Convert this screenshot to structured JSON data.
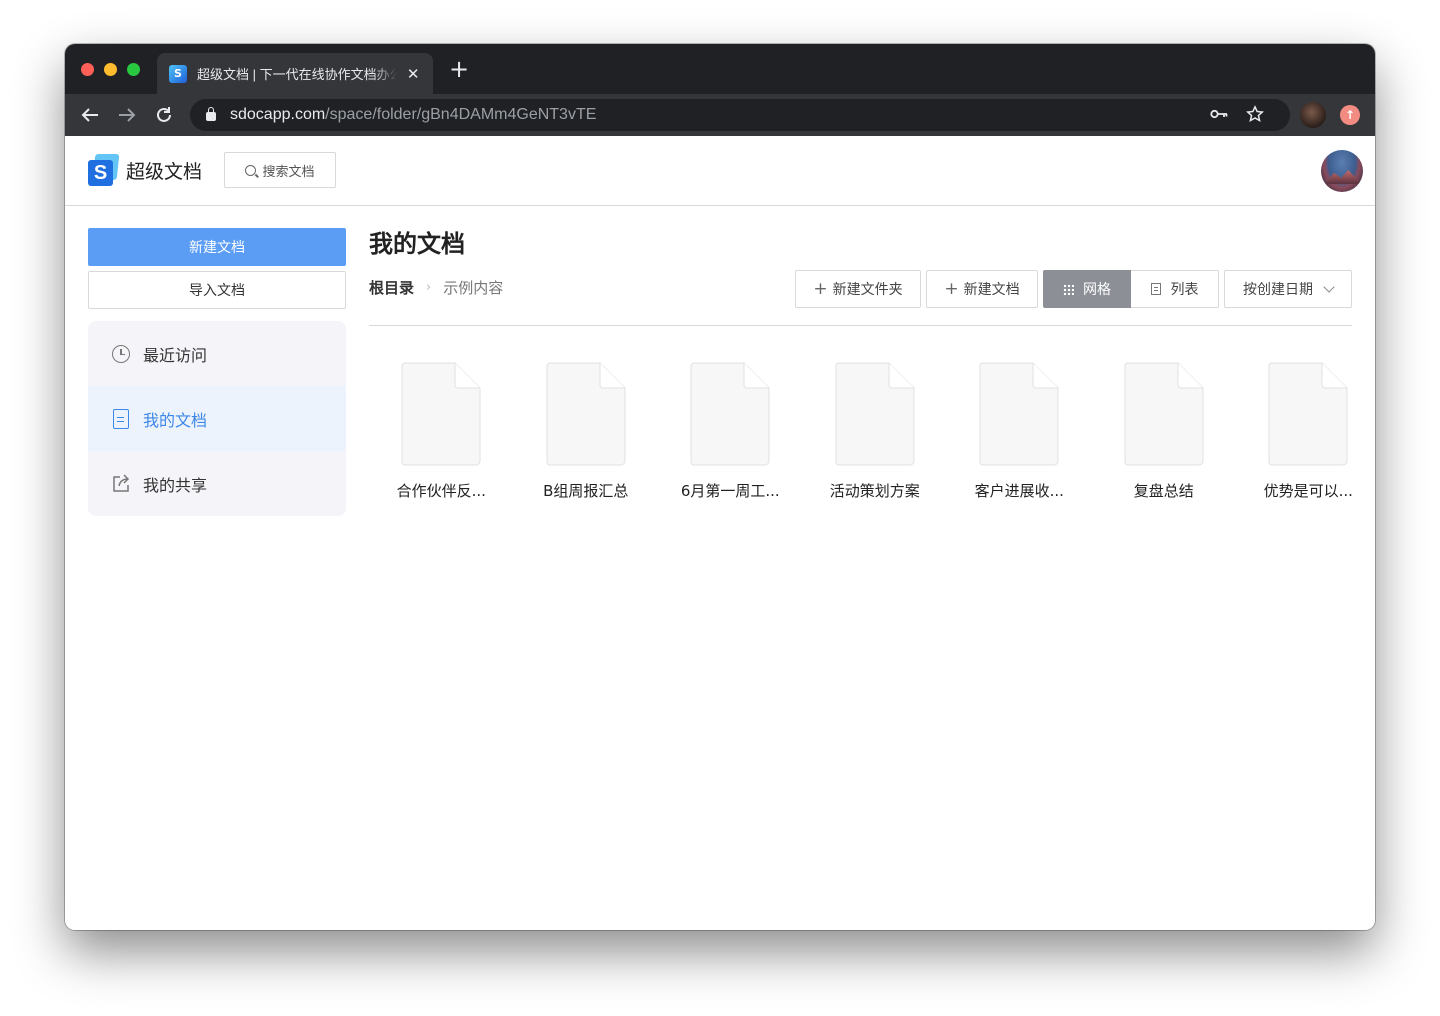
{
  "browser": {
    "tab_title": "超级文档 | 下一代在线协作文档办公",
    "tab_favicon": "S",
    "tab_close": "✕",
    "new_tab": "+",
    "url_host": "sdocapp.com",
    "url_path": "/space/folder/gBn4DAMm4GeNT3vTE",
    "icons": [
      "back-arrow-icon",
      "forward-arrow-icon",
      "reload-icon",
      "lock-icon",
      "key-icon",
      "star-icon",
      "profile-avatar",
      "update-icon"
    ]
  },
  "header": {
    "logo_letter": "S",
    "logo_text": "超级文档",
    "search_label": "搜索文档"
  },
  "sidebar": {
    "new_doc": "新建文档",
    "import_doc": "导入文档",
    "items": [
      {
        "label": "最近访问",
        "icon": "clock-icon"
      },
      {
        "label": "我的文档",
        "icon": "document-icon",
        "active": true
      },
      {
        "label": "我的共享",
        "icon": "share-icon"
      }
    ]
  },
  "main": {
    "title": "我的文档",
    "breadcrumb": {
      "root": "根目录",
      "separator": "›",
      "current": "示例内容"
    },
    "actions": {
      "new_folder": "新建文件夹",
      "new_doc": "新建文档",
      "view_grid": "网格",
      "view_list": "列表",
      "sort": "按创建日期"
    },
    "files": [
      "合作伙伴反...",
      "B组周报汇总",
      "6月第一周工...",
      "活动策划方案",
      "客户进展收...",
      "复盘总结",
      "优势是可以..."
    ]
  },
  "colors": {
    "primary": "#5b9cf5",
    "active_text": "#3d87e6",
    "active_bg": "#edf3fd",
    "segment_active": "#8c8f96",
    "sidebar_bg": "#f5f5f9"
  }
}
